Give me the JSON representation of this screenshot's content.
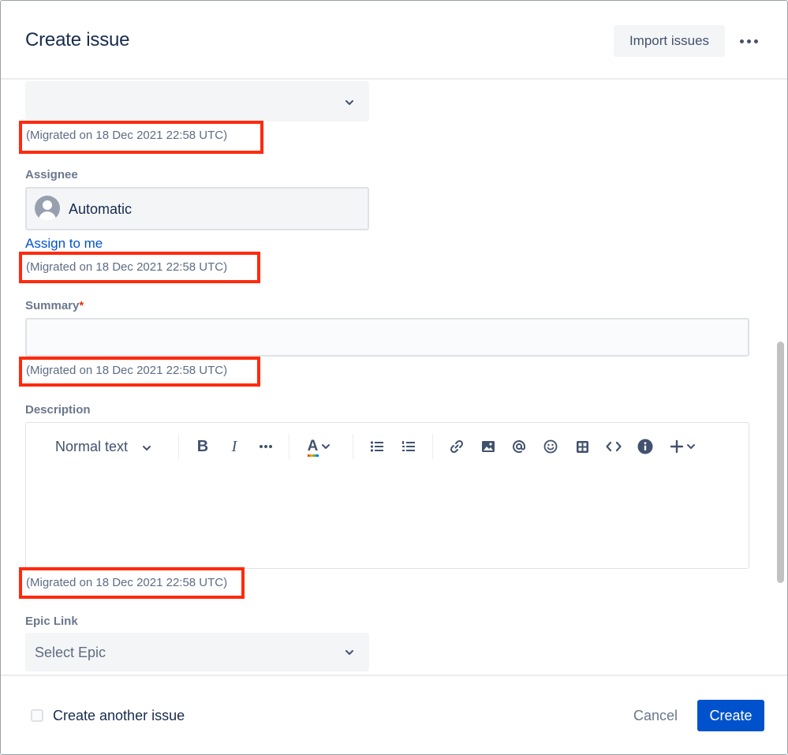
{
  "header": {
    "title": "Create issue",
    "import_label": "Import issues",
    "more_icon": "more-horizontal-icon"
  },
  "fields": {
    "top_select": {
      "value": "",
      "icon": "chevron-down-icon"
    },
    "migrated_note": "(Migrated on 18 Dec 2021 22:58 UTC)",
    "assignee": {
      "label": "Assignee",
      "value": "Automatic",
      "avatar_icon": "user-avatar-icon",
      "assign_to_me": "Assign to me"
    },
    "summary": {
      "label": "Summary",
      "required_mark": "*",
      "value": ""
    },
    "description": {
      "label": "Description",
      "text_style": "Normal text",
      "toolbar": [
        "chevron-down-icon",
        "bold-icon",
        "italic-icon",
        "more-formatting-icon",
        "text-color-icon",
        "bullet-list-icon",
        "numbered-list-icon",
        "link-icon",
        "image-icon",
        "mention-icon",
        "emoji-icon",
        "table-icon",
        "code-icon",
        "info-icon",
        "insert-plus-icon"
      ],
      "bold_glyph": "B",
      "italic_glyph": "I",
      "color_glyph": "A"
    },
    "epic_link": {
      "label": "Epic Link",
      "placeholder": "Select Epic"
    }
  },
  "footer": {
    "create_another_label": "Create another issue",
    "create_another_checked": false,
    "cancel_label": "Cancel",
    "create_label": "Create"
  },
  "colors": {
    "primary": "#0052cc",
    "highlight_box": "#ff2a0e",
    "required": "#de350b"
  }
}
